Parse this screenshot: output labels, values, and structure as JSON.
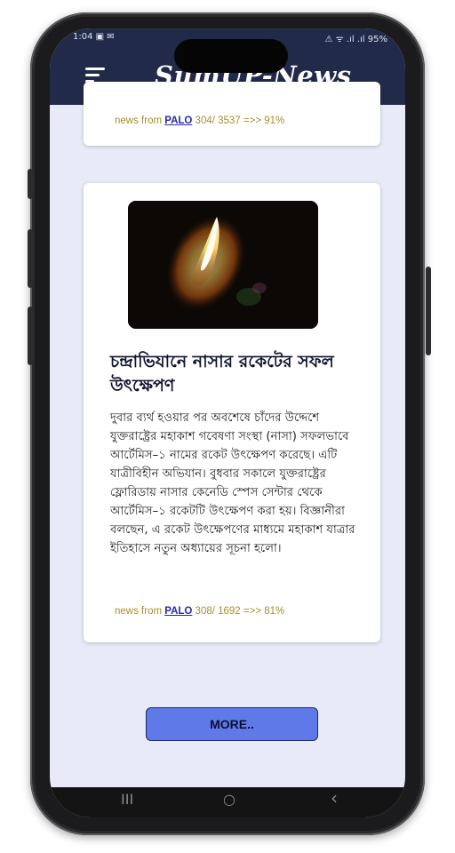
{
  "status_bar": {
    "left_text": "1:04 ▣ ✉",
    "right_text": "⚠ ᯤ .ıl .ıl 95%"
  },
  "header": {
    "title": "SumUP-News"
  },
  "articles": [
    {
      "footer_prefix": "news from",
      "source": "PALO",
      "stats": "304/ 3537 =>> 91%"
    },
    {
      "image": "rocket-launch-image",
      "headline": "চন্দ্রাভিযানে নাসার রকেটের সফল উৎক্ষেপণ",
      "summary": "দুবার ব্যর্থ হওয়ার পর অবশেষে চাঁদের উদ্দেশে যুক্তরাষ্ট্রের মহাকাশ গবেষণা সংস্থা (নাসা) সফলভাবে আর্টেমিস–১ নামের রকেট উৎক্ষেপণ করেছে। এটি যাত্রীবিহীন অভিযান। বুধবার সকালে যুক্তরাষ্ট্রের ফ্লোরিডায় নাসার কেনেডি স্পেস সেন্টার থেকে আর্টেমিস–১ রকেটটি উৎক্ষেপণ করা হয়। বিজ্ঞানীরা বলছেন, এ রকেট উৎক্ষেপণের মাধ্যমে মহাকাশ যাত্রার ইতিহাসে নতুন অধ্যায়ের সূচনা হলো।",
      "footer_prefix": "news from",
      "source": "PALO",
      "stats": "308/ 1692 =>> 81%"
    }
  ],
  "more_button": {
    "label": "MORE.."
  },
  "nav": {
    "recents": "III",
    "home": "○",
    "back": "‹"
  },
  "colors": {
    "header_bg": "#222a4a",
    "screen_bg": "#e8ebf7",
    "footer_text": "#a58f2d",
    "button_bg": "#5f7ae8"
  }
}
